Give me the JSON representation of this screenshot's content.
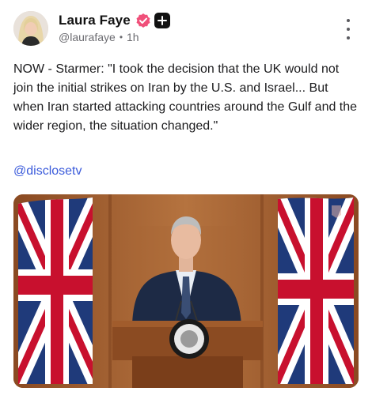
{
  "author": {
    "display_name": "Laura Faye",
    "handle": "@laurafaye",
    "time_ago": "1h",
    "separator": "•",
    "avatar": "avatar-photo"
  },
  "icons": {
    "verified": "verified-badge-icon",
    "plus": "plus-badge-icon",
    "more": "more-vertical-icon"
  },
  "colors": {
    "verified_badge": "#f0507a",
    "mention_link": "#3b5bdb"
  },
  "post": {
    "text": "NOW - Starmer: \"I took the decision that the UK would not join the initial strikes on Iran by the U.S. and Israel... But when Iran started attacking countries around the Gulf and the wider region, the situation changed.\"",
    "mention": "@disclosetv"
  },
  "media": {
    "type": "video-still",
    "description_icon": "video-frame"
  }
}
